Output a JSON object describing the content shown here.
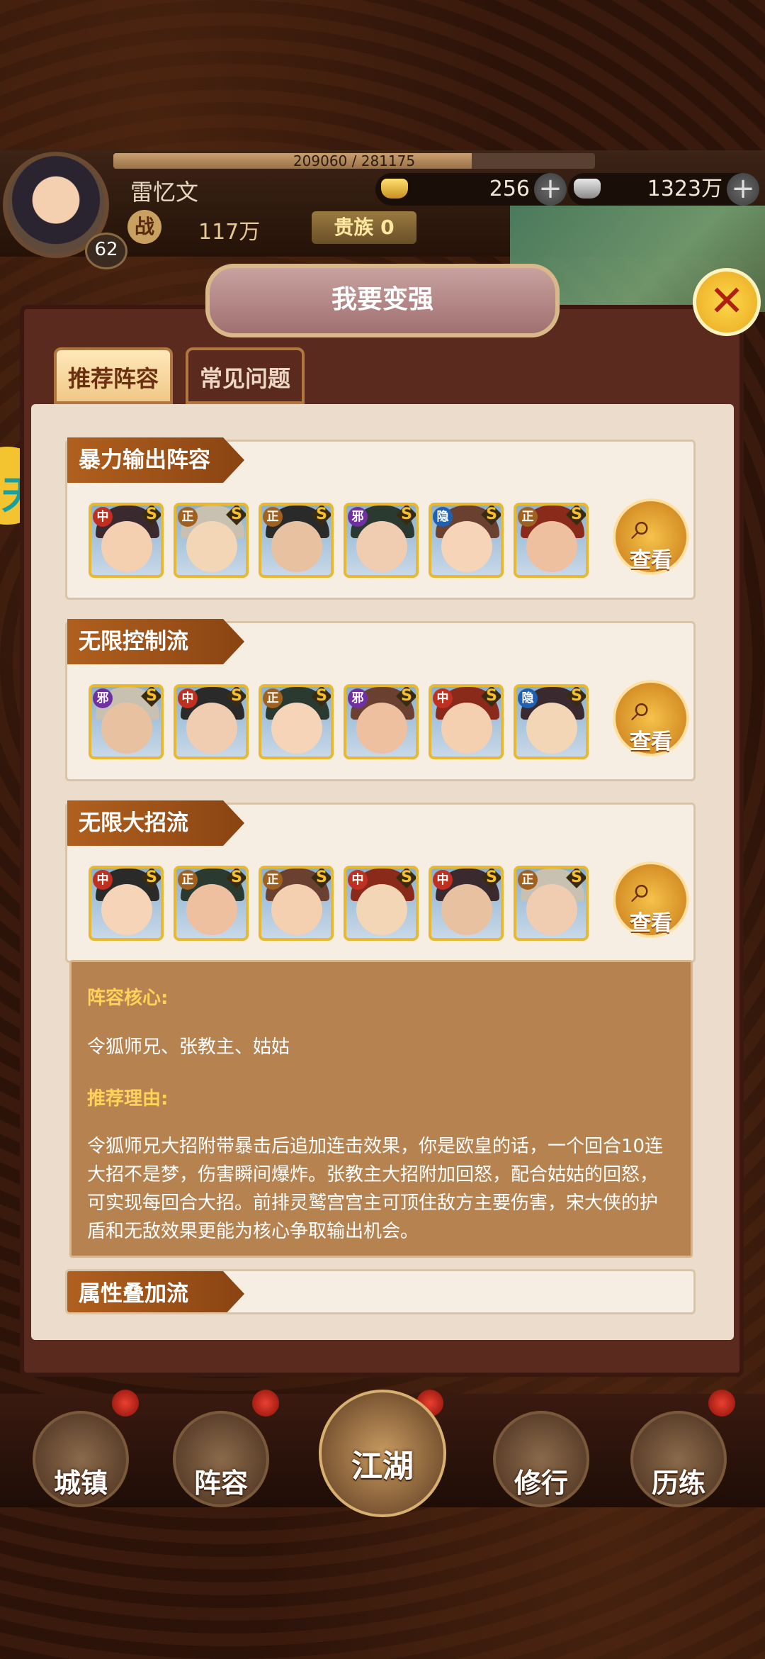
{
  "player": {
    "name": "雷忆文",
    "level": "62",
    "exp_text": "209060 / 281175",
    "exp_fraction": 0.744,
    "power": "117万",
    "noble": "贵族 0",
    "power_icon": "战"
  },
  "resources": [
    {
      "icon": "gold-ingot-icon",
      "value": "256"
    },
    {
      "icon": "silver-ingot-icon",
      "value": "1323万"
    }
  ],
  "dialog": {
    "title": "我要变强",
    "close_icon": "✕",
    "tabs": [
      "推荐阵容",
      "常见问题"
    ]
  },
  "lineups": [
    {
      "name": "暴力输出阵容",
      "view_label": "查看",
      "heroes": [
        {
          "faction": "中",
          "grade": "S"
        },
        {
          "faction": "正",
          "grade": "S"
        },
        {
          "faction": "正",
          "grade": "S"
        },
        {
          "faction": "邪",
          "grade": "S"
        },
        {
          "faction": "隐",
          "grade": "S"
        },
        {
          "faction": "正",
          "grade": "S"
        }
      ]
    },
    {
      "name": "无限控制流",
      "view_label": "查看",
      "heroes": [
        {
          "faction": "邪",
          "grade": "S"
        },
        {
          "faction": "中",
          "grade": "S"
        },
        {
          "faction": "正",
          "grade": "S"
        },
        {
          "faction": "邪",
          "grade": "S"
        },
        {
          "faction": "中",
          "grade": "S"
        },
        {
          "faction": "隐",
          "grade": "S"
        }
      ]
    },
    {
      "name": "无限大招流",
      "view_label": "查看",
      "heroes": [
        {
          "faction": "中",
          "grade": "S"
        },
        {
          "faction": "正",
          "grade": "S"
        },
        {
          "faction": "正",
          "grade": "S"
        },
        {
          "faction": "中",
          "grade": "S"
        },
        {
          "faction": "中",
          "grade": "S"
        },
        {
          "faction": "正",
          "grade": "S"
        }
      ]
    }
  ],
  "detail": {
    "core_heading": "阵容核心:",
    "core_text": "令狐师兄、张教主、姑姑",
    "reason_heading": "推荐理由:",
    "reason_text": "令狐师兄大招附带暴击后追加连击效果，你是欧皇的话，一个回合10连大招不是梦，伤害瞬间爆炸。张教主大招附加回怒，配合姑姑的回怒，可实现每回合大招。前排灵鹫宫宫主可顶住敌方主要伤害，宋大侠的护盾和无敌效果更能为核心争取输出机会。"
  },
  "partial_lineup": {
    "name": "属性叠加流"
  },
  "bottom_nav": [
    {
      "label": "城镇"
    },
    {
      "label": "阵容"
    },
    {
      "label": "江湖"
    },
    {
      "label": "修行"
    },
    {
      "label": "历练"
    }
  ],
  "colors": {
    "accent_gold": "#f6c24a",
    "label_orange": "#b0601e",
    "panel_bg": "#ebdccb",
    "detail_bg": "#b58250"
  }
}
